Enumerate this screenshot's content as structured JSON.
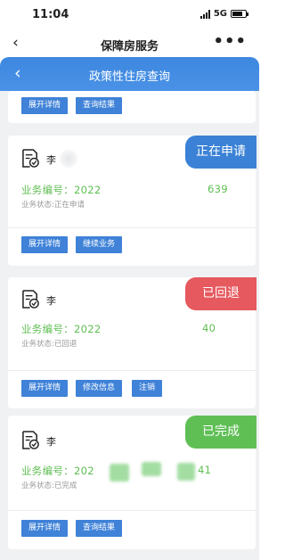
{
  "status_bar": {
    "time": "11:04",
    "network": "5G"
  },
  "app_header": {
    "back": "‹",
    "title": "保障房服务",
    "more": "•••"
  },
  "nav_bar": {
    "back": "‹",
    "title": "政策性住房查询"
  },
  "top_card": {
    "buttons": [
      "展开详情",
      "查询结果"
    ]
  },
  "records": [
    {
      "name": "李",
      "business_no_label": "业务编号：",
      "business_no_start": "2022",
      "business_no_end": "639",
      "status_text": "业务状态:正在申请",
      "badge": "正在申请",
      "badge_color": "#3b82d6",
      "buttons": [
        "展开详情",
        "继续业务"
      ]
    },
    {
      "name": "李",
      "business_no_label": "业务编号：",
      "business_no_start": "2022",
      "business_no_end": "40",
      "status_text": "业务状态:已回退",
      "badge": "已回退",
      "badge_color": "#e5595f",
      "buttons": [
        "展开详情",
        "修改信息",
        "注销"
      ]
    },
    {
      "name": "李",
      "business_no_label": "业务编号：",
      "business_no_start": "202",
      "business_no_end": "41",
      "status_text": "业务状态:已完成",
      "badge": "已完成",
      "badge_color": "#5fbf55",
      "buttons": [
        "展开详情",
        "查询结果"
      ]
    }
  ]
}
